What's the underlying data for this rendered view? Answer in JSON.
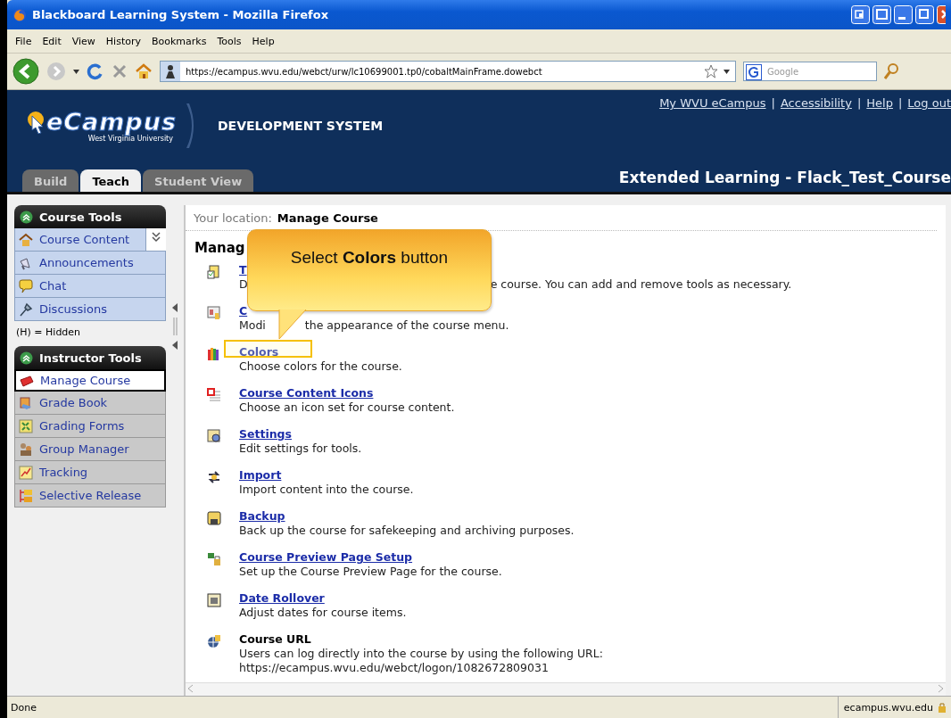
{
  "window": {
    "title": "Blackboard Learning System - Mozilla Firefox"
  },
  "menu": [
    "File",
    "Edit",
    "View",
    "History",
    "Bookmarks",
    "Tools",
    "Help"
  ],
  "navigation": {
    "url": "https://ecampus.wvu.edu/webct/urw/lc10699001.tp0/cobaltMainFrame.dowebct",
    "search_placeholder": "Google"
  },
  "header": {
    "logo": "eCampus",
    "logo_subtitle": "West Virginia University",
    "system": "DEVELOPMENT SYSTEM",
    "links": [
      {
        "label": "My WVU eCampus",
        "separator": "|"
      },
      {
        "label": "Accessibility",
        "separator": "|"
      },
      {
        "label": "Help",
        "separator": "|"
      },
      {
        "label": "Log out"
      }
    ],
    "tabs": [
      {
        "label": "Build",
        "selected": false
      },
      {
        "label": "Teach",
        "selected": true
      },
      {
        "label": "Student View",
        "selected": false
      }
    ],
    "course_title": "Extended Learning - Flack_Test_Course"
  },
  "sidebar": {
    "sections": [
      {
        "title": "Course Tools",
        "items": [
          {
            "label": "Course Content",
            "selected": false
          },
          {
            "label": "Announcements",
            "selected": false
          },
          {
            "label": "Chat",
            "selected": false
          },
          {
            "label": "Discussions",
            "selected": false
          }
        ],
        "note": "(H) = Hidden"
      },
      {
        "title": "Instructor Tools",
        "items": [
          {
            "label": "Manage Course",
            "selected": true
          },
          {
            "label": "Grade Book",
            "selected": false
          },
          {
            "label": "Grading Forms",
            "selected": false
          },
          {
            "label": "Group Manager",
            "selected": false
          },
          {
            "label": "Tracking",
            "selected": false
          },
          {
            "label": "Selective Release",
            "selected": false
          }
        ]
      }
    ]
  },
  "location": {
    "label": "Your location:",
    "value": "Manage Course"
  },
  "heading": "Manag",
  "items": [
    {
      "title": "T",
      "description": [
        "D",
        "e course. You can add and remove tools as necessary."
      ]
    },
    {
      "title": "C",
      "description": [
        "Modi",
        "the appearance of the course menu."
      ]
    },
    {
      "title": "Colors",
      "description": [
        "Choose colors for the course."
      ]
    },
    {
      "title": "Course Content Icons",
      "description": [
        "Choose an icon set for course content."
      ]
    },
    {
      "title": "Settings",
      "description": [
        "Edit settings for tools."
      ]
    },
    {
      "title": "Import",
      "description": [
        "Import content into the course."
      ]
    },
    {
      "title": "Backup",
      "description": [
        "Back up the course for safekeeping and archiving purposes."
      ]
    },
    {
      "title": "Course Preview Page Setup",
      "description": [
        "Set up the Course Preview Page for the course."
      ]
    },
    {
      "title": "Date Rollover",
      "description": [
        "Adjust dates for course items."
      ]
    },
    {
      "title": "Course URL",
      "kind": "plain",
      "description": [
        "Users can log directly into the course by using the following URL:",
        "https://ecampus.wvu.edu/webct/logon/1082672809031"
      ]
    }
  ],
  "callout": "Select **Colors** button",
  "status": {
    "text": "Done",
    "host": "ecampus.wvu.edu"
  }
}
